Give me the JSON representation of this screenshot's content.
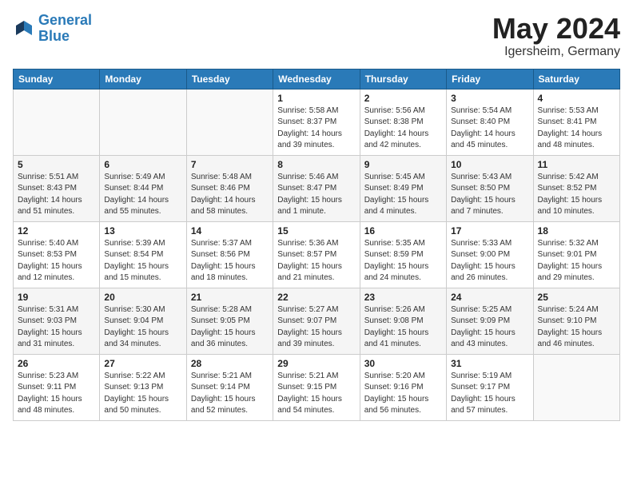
{
  "header": {
    "logo_line1": "General",
    "logo_line2": "Blue",
    "month": "May 2024",
    "location": "Igersheim, Germany"
  },
  "weekdays": [
    "Sunday",
    "Monday",
    "Tuesday",
    "Wednesday",
    "Thursday",
    "Friday",
    "Saturday"
  ],
  "weeks": [
    [
      {
        "day": "",
        "info": ""
      },
      {
        "day": "",
        "info": ""
      },
      {
        "day": "",
        "info": ""
      },
      {
        "day": "1",
        "info": "Sunrise: 5:58 AM\nSunset: 8:37 PM\nDaylight: 14 hours\nand 39 minutes."
      },
      {
        "day": "2",
        "info": "Sunrise: 5:56 AM\nSunset: 8:38 PM\nDaylight: 14 hours\nand 42 minutes."
      },
      {
        "day": "3",
        "info": "Sunrise: 5:54 AM\nSunset: 8:40 PM\nDaylight: 14 hours\nand 45 minutes."
      },
      {
        "day": "4",
        "info": "Sunrise: 5:53 AM\nSunset: 8:41 PM\nDaylight: 14 hours\nand 48 minutes."
      }
    ],
    [
      {
        "day": "5",
        "info": "Sunrise: 5:51 AM\nSunset: 8:43 PM\nDaylight: 14 hours\nand 51 minutes."
      },
      {
        "day": "6",
        "info": "Sunrise: 5:49 AM\nSunset: 8:44 PM\nDaylight: 14 hours\nand 55 minutes."
      },
      {
        "day": "7",
        "info": "Sunrise: 5:48 AM\nSunset: 8:46 PM\nDaylight: 14 hours\nand 58 minutes."
      },
      {
        "day": "8",
        "info": "Sunrise: 5:46 AM\nSunset: 8:47 PM\nDaylight: 15 hours\nand 1 minute."
      },
      {
        "day": "9",
        "info": "Sunrise: 5:45 AM\nSunset: 8:49 PM\nDaylight: 15 hours\nand 4 minutes."
      },
      {
        "day": "10",
        "info": "Sunrise: 5:43 AM\nSunset: 8:50 PM\nDaylight: 15 hours\nand 7 minutes."
      },
      {
        "day": "11",
        "info": "Sunrise: 5:42 AM\nSunset: 8:52 PM\nDaylight: 15 hours\nand 10 minutes."
      }
    ],
    [
      {
        "day": "12",
        "info": "Sunrise: 5:40 AM\nSunset: 8:53 PM\nDaylight: 15 hours\nand 12 minutes."
      },
      {
        "day": "13",
        "info": "Sunrise: 5:39 AM\nSunset: 8:54 PM\nDaylight: 15 hours\nand 15 minutes."
      },
      {
        "day": "14",
        "info": "Sunrise: 5:37 AM\nSunset: 8:56 PM\nDaylight: 15 hours\nand 18 minutes."
      },
      {
        "day": "15",
        "info": "Sunrise: 5:36 AM\nSunset: 8:57 PM\nDaylight: 15 hours\nand 21 minutes."
      },
      {
        "day": "16",
        "info": "Sunrise: 5:35 AM\nSunset: 8:59 PM\nDaylight: 15 hours\nand 24 minutes."
      },
      {
        "day": "17",
        "info": "Sunrise: 5:33 AM\nSunset: 9:00 PM\nDaylight: 15 hours\nand 26 minutes."
      },
      {
        "day": "18",
        "info": "Sunrise: 5:32 AM\nSunset: 9:01 PM\nDaylight: 15 hours\nand 29 minutes."
      }
    ],
    [
      {
        "day": "19",
        "info": "Sunrise: 5:31 AM\nSunset: 9:03 PM\nDaylight: 15 hours\nand 31 minutes."
      },
      {
        "day": "20",
        "info": "Sunrise: 5:30 AM\nSunset: 9:04 PM\nDaylight: 15 hours\nand 34 minutes."
      },
      {
        "day": "21",
        "info": "Sunrise: 5:28 AM\nSunset: 9:05 PM\nDaylight: 15 hours\nand 36 minutes."
      },
      {
        "day": "22",
        "info": "Sunrise: 5:27 AM\nSunset: 9:07 PM\nDaylight: 15 hours\nand 39 minutes."
      },
      {
        "day": "23",
        "info": "Sunrise: 5:26 AM\nSunset: 9:08 PM\nDaylight: 15 hours\nand 41 minutes."
      },
      {
        "day": "24",
        "info": "Sunrise: 5:25 AM\nSunset: 9:09 PM\nDaylight: 15 hours\nand 43 minutes."
      },
      {
        "day": "25",
        "info": "Sunrise: 5:24 AM\nSunset: 9:10 PM\nDaylight: 15 hours\nand 46 minutes."
      }
    ],
    [
      {
        "day": "26",
        "info": "Sunrise: 5:23 AM\nSunset: 9:11 PM\nDaylight: 15 hours\nand 48 minutes."
      },
      {
        "day": "27",
        "info": "Sunrise: 5:22 AM\nSunset: 9:13 PM\nDaylight: 15 hours\nand 50 minutes."
      },
      {
        "day": "28",
        "info": "Sunrise: 5:21 AM\nSunset: 9:14 PM\nDaylight: 15 hours\nand 52 minutes."
      },
      {
        "day": "29",
        "info": "Sunrise: 5:21 AM\nSunset: 9:15 PM\nDaylight: 15 hours\nand 54 minutes."
      },
      {
        "day": "30",
        "info": "Sunrise: 5:20 AM\nSunset: 9:16 PM\nDaylight: 15 hours\nand 56 minutes."
      },
      {
        "day": "31",
        "info": "Sunrise: 5:19 AM\nSunset: 9:17 PM\nDaylight: 15 hours\nand 57 minutes."
      },
      {
        "day": "",
        "info": ""
      }
    ]
  ]
}
